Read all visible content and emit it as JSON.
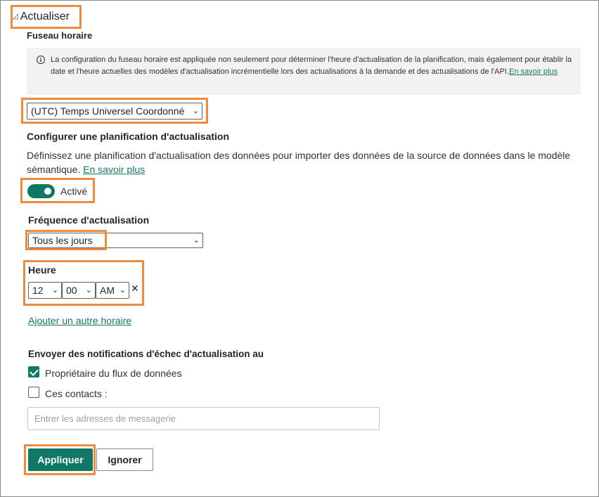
{
  "section": {
    "title": "Actualiser",
    "caret": "◿"
  },
  "timezone": {
    "label": "Fuseau horaire",
    "info_icon": "i",
    "info_text": "La configuration du fuseau horaire est appliquée non seulement pour déterminer l'heure d'actualisation de la planification, mais également pour établir la date et l'heure actuelles des modèles d'actualisation incrémentielle lors des actualisations à la demande et des actualisations de l'API.",
    "info_link": "En savoir plus",
    "selected": "(UTC) Temps Universel Coordonné"
  },
  "schedule": {
    "heading": "Configurer une planification d'actualisation",
    "description": "Définissez une planification d'actualisation des données pour importer des données de la source de données dans le modèle sémantique.",
    "link": "En savoir plus",
    "toggle_label": "Activé",
    "toggle_on": true
  },
  "frequency": {
    "label": "Fréquence d'actualisation",
    "selected": "Tous les jours"
  },
  "time": {
    "label": "Heure",
    "hour": "12",
    "minute": "00",
    "ampm": "AM",
    "remove_icon": "✕",
    "add_link": "Ajouter un autre horaire"
  },
  "notifications": {
    "heading": "Envoyer des notifications d'échec d'actualisation au",
    "owner_label": "Propriétaire du flux de données",
    "owner_checked": true,
    "contacts_label": "Ces contacts :",
    "contacts_checked": false,
    "email_placeholder": "Entrer les adresses de messagerie"
  },
  "buttons": {
    "apply": "Appliquer",
    "ignore": "Ignorer"
  },
  "colors": {
    "accent": "#117865",
    "highlight": "#f08a3c"
  }
}
